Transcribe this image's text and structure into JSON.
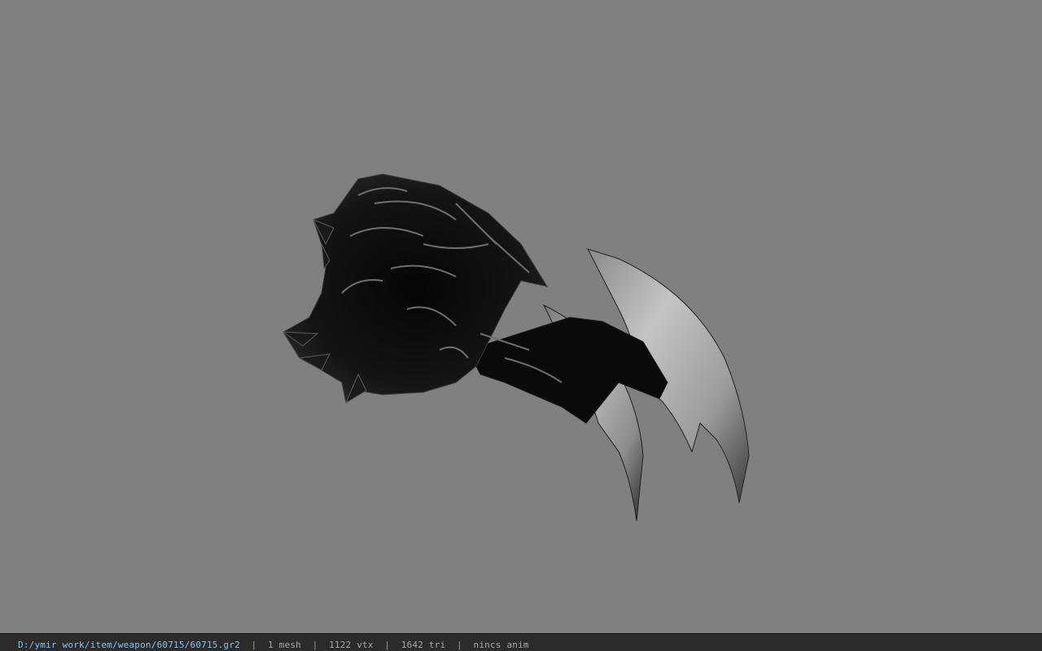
{
  "viewport": {
    "background_color": "#808080",
    "model": "claw-weapon-model"
  },
  "status_bar": {
    "file_path": "D:/ymir work/item/weapon/60715/60715.gr2",
    "separator": "  |  ",
    "mesh_count": "1 mesh",
    "vertex_count": "1122 vtx",
    "triangle_count": "1642 tri",
    "anim_status": "nincs anim",
    "path_color": "#8fc0e8",
    "text_color": "#a8a8a8",
    "background_color": "#2b2b2b"
  }
}
